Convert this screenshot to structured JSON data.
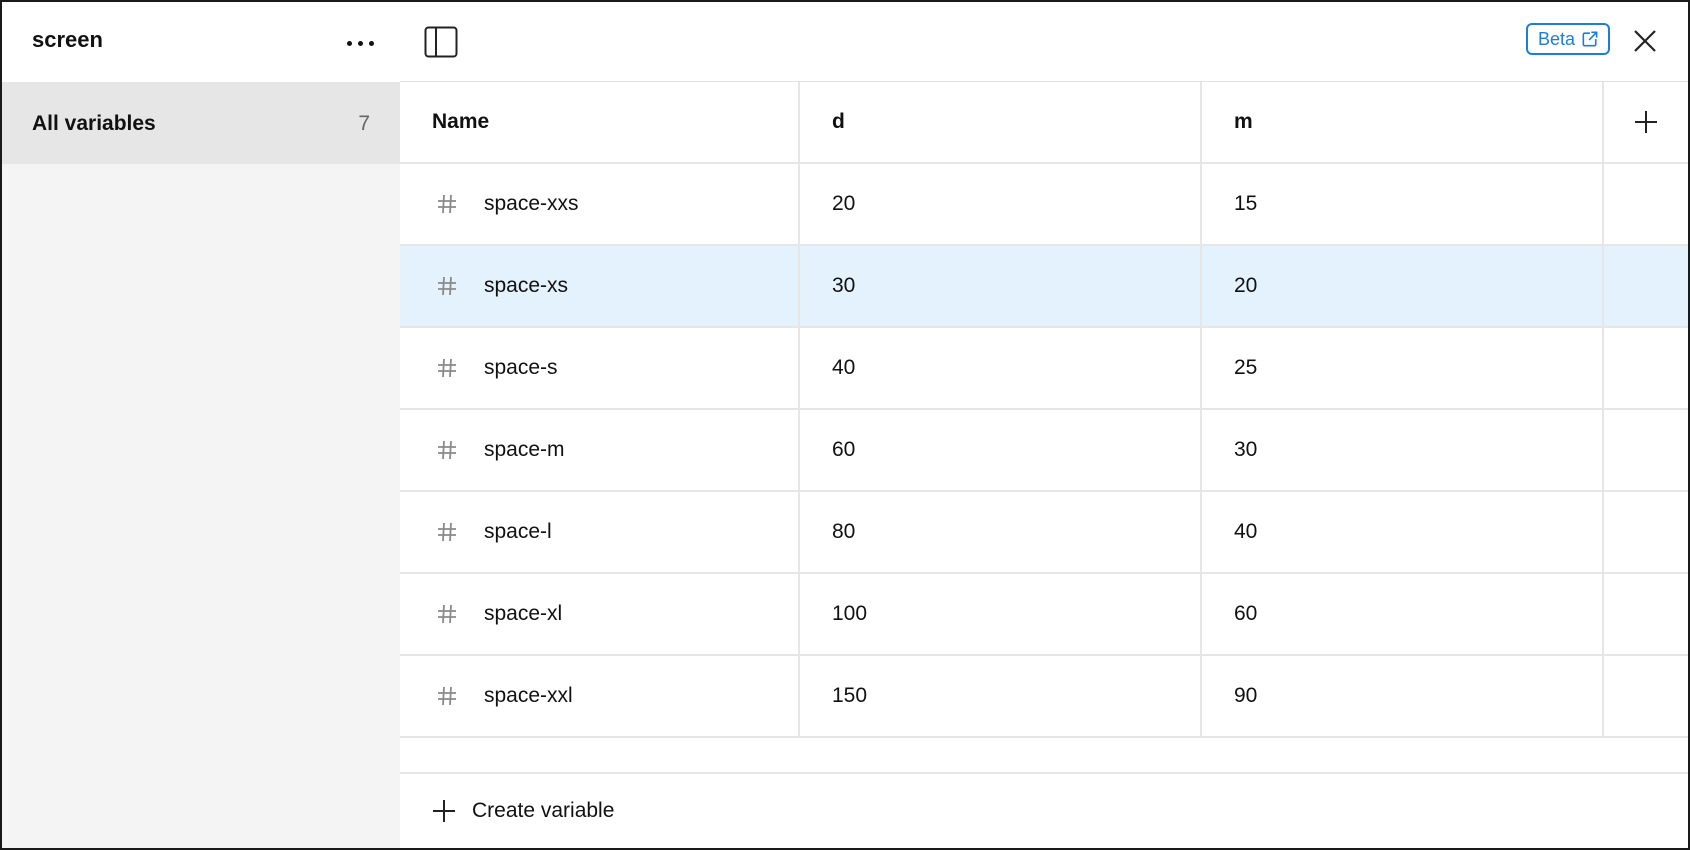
{
  "sidebar": {
    "collection_title": "screen",
    "items": [
      {
        "label": "All variables",
        "count": "7"
      }
    ]
  },
  "topbar": {
    "beta_label": "Beta"
  },
  "table": {
    "headers": {
      "name": "Name",
      "col_d": "d",
      "col_m": "m"
    },
    "rows": [
      {
        "name": "space-xxs",
        "d": "20",
        "m": "15"
      },
      {
        "name": "space-xs",
        "d": "30",
        "m": "20",
        "selected": true
      },
      {
        "name": "space-s",
        "d": "40",
        "m": "25"
      },
      {
        "name": "space-m",
        "d": "60",
        "m": "30"
      },
      {
        "name": "space-l",
        "d": "80",
        "m": "40"
      },
      {
        "name": "space-xl",
        "d": "100",
        "m": "60"
      },
      {
        "name": "space-xxl",
        "d": "150",
        "m": "90"
      }
    ]
  },
  "footer": {
    "create_label": "Create variable"
  },
  "colors": {
    "selected_row": "#e3f2fd",
    "accent": "#1b7fd9",
    "sidebar_bg": "#f4f4f4",
    "sidebar_active": "#e6e6e6"
  },
  "icons": {
    "more": "more-horizontal-icon",
    "sidebar_toggle": "sidebar-toggle-icon",
    "external_link": "external-link-icon",
    "close": "close-icon",
    "add": "plus-icon",
    "number_type": "hash-icon"
  }
}
